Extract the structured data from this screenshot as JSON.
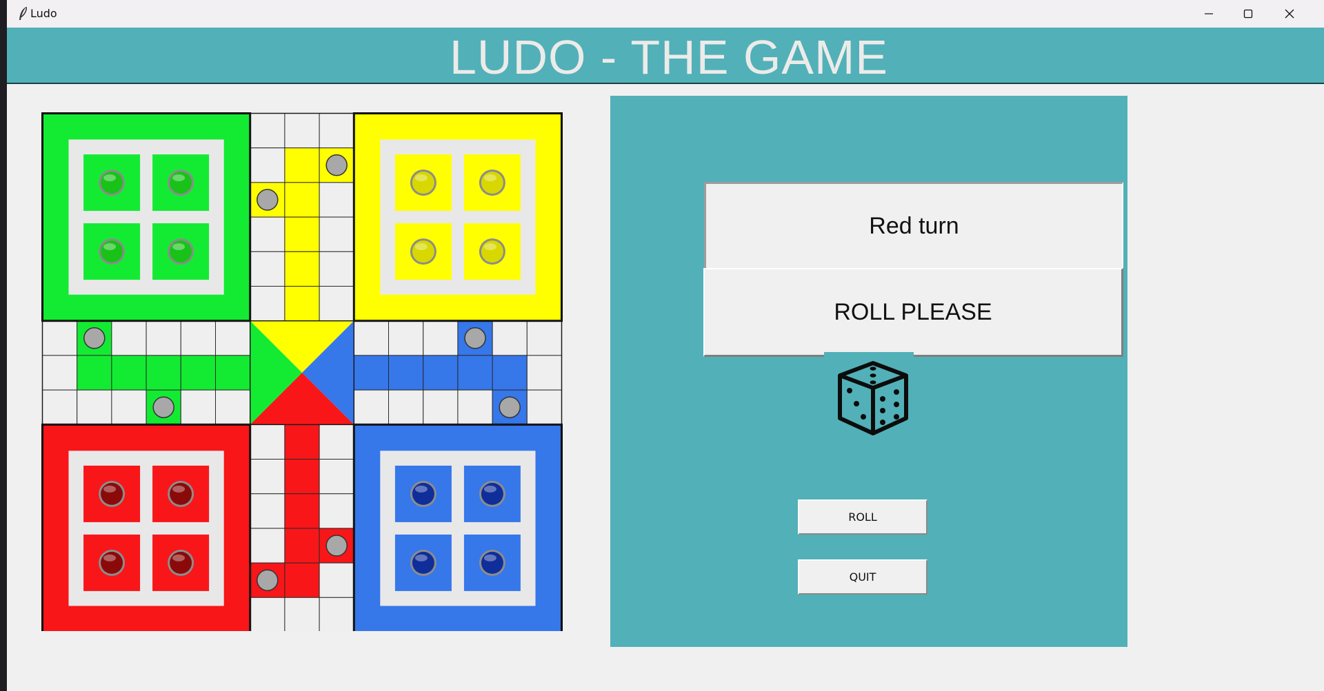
{
  "window": {
    "title": "Ludo",
    "controls": [
      "minimize",
      "maximize",
      "close"
    ]
  },
  "header": {
    "title": "LUDO - THE GAME"
  },
  "panel": {
    "turn_text": "Red turn",
    "prompt_text": "ROLL PLEASE",
    "dice_icon": "dice-icon",
    "roll_label": "ROLL",
    "quit_label": "QUIT"
  },
  "board": {
    "colors": {
      "green": "#13eb32",
      "yellow": "#ffff00",
      "red": "#f81619",
      "blue": "#3677ea",
      "inner": "#e9e8e9",
      "cell": "#efefef",
      "safe_marker": "#a8a8a8"
    },
    "home_tokens": {
      "green": 4,
      "yellow": 4,
      "red": 4,
      "blue": 4
    },
    "token_colors": {
      "green": "#19c219",
      "yellow": "#d8d800",
      "red": "#8a0a0a",
      "blue": "#0f2e9a"
    }
  },
  "accent": "#52b0b8"
}
